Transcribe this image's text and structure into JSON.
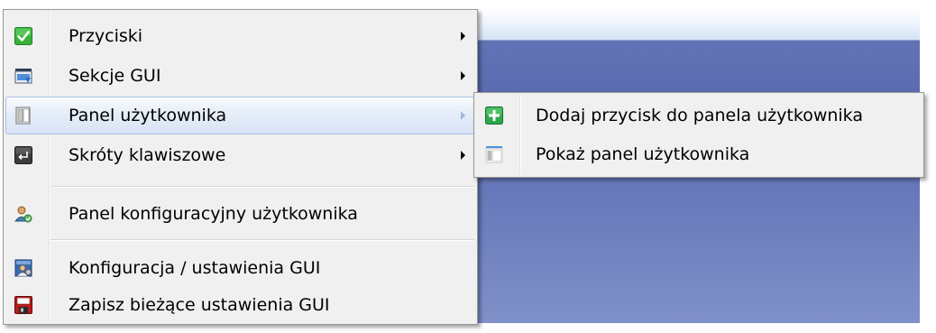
{
  "menu": {
    "items": [
      {
        "label": "Przyciski",
        "icon": "checkmark-icon",
        "has_submenu": true
      },
      {
        "label": "Sekcje GUI",
        "icon": "window-sections-icon",
        "has_submenu": true
      },
      {
        "label": "Panel użytkownika",
        "icon": "user-panel-icon",
        "has_submenu": true,
        "highlighted": true
      },
      {
        "label": "Skróty klawiszowe",
        "icon": "keyboard-shortcut-icon",
        "has_submenu": true
      },
      {
        "label": "Panel konfiguracyjny użytkownika",
        "icon": "user-config-icon",
        "has_submenu": false
      },
      {
        "label": "Konfiguracja / ustawienia GUI",
        "icon": "gui-settings-icon",
        "has_submenu": false
      },
      {
        "label": "Zapisz bieżące ustawienia GUI",
        "icon": "save-icon",
        "has_submenu": false
      }
    ]
  },
  "submenu": {
    "items": [
      {
        "label": "Dodaj przycisk do panela użytkownika",
        "icon": "add-icon"
      },
      {
        "label": "Pokaż panel użytkownika",
        "icon": "show-panel-icon"
      }
    ]
  },
  "colors": {
    "menu_bg": "#f0f0f0",
    "highlight_border": "#a8c4e8",
    "app_background": "#6677b8",
    "checkmark_green": "#38b23a",
    "save_red": "#b81c1c"
  }
}
